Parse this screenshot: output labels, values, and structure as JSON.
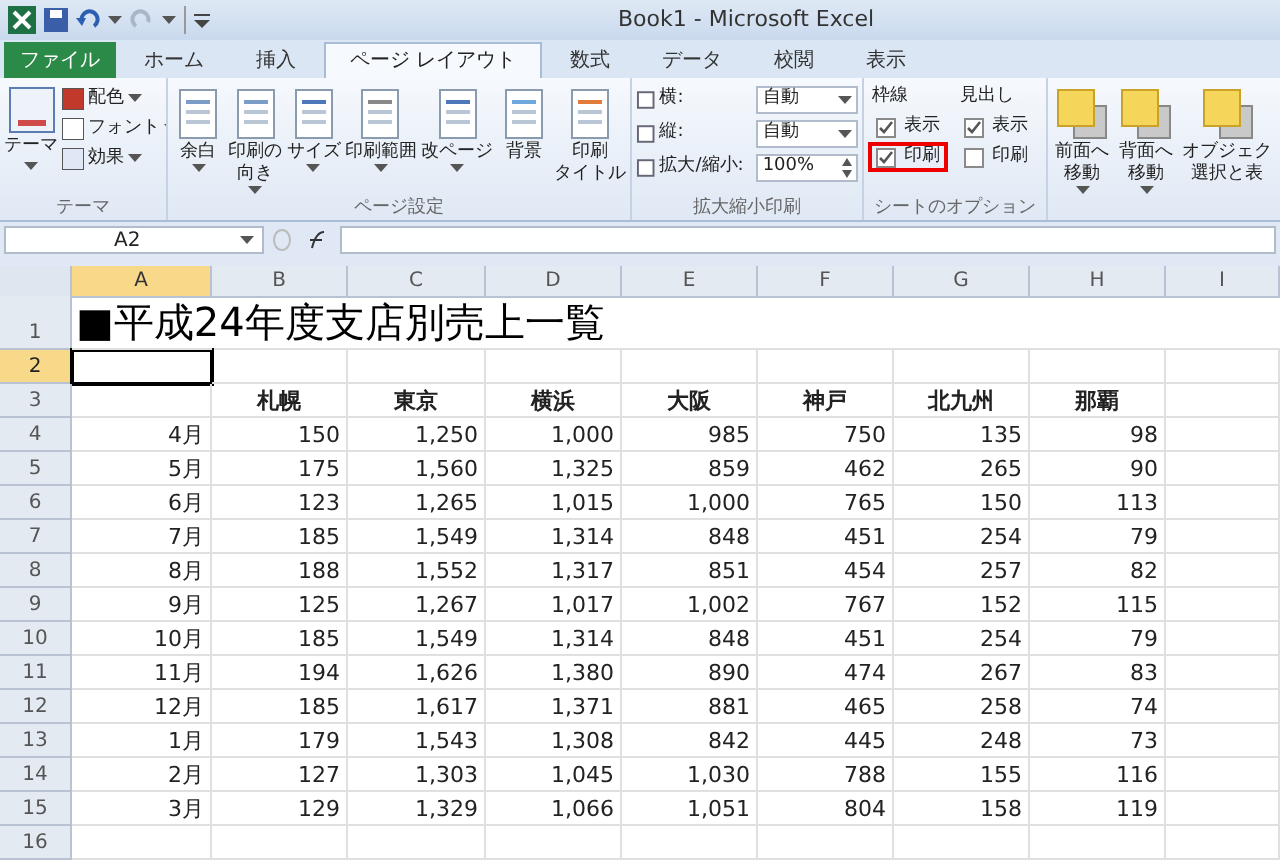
{
  "window": {
    "title": "Book1 - Microsoft Excel"
  },
  "tabs": [
    {
      "label": "ファイル",
      "selected": false,
      "kind": "file"
    },
    {
      "label": "ホーム",
      "selected": false,
      "kind": "tab"
    },
    {
      "label": "挿入",
      "selected": false,
      "kind": "tab"
    },
    {
      "label": "ページ レイアウト",
      "selected": true,
      "kind": "tab"
    },
    {
      "label": "数式",
      "selected": false,
      "kind": "tab"
    },
    {
      "label": "データ",
      "selected": false,
      "kind": "tab"
    },
    {
      "label": "校閲",
      "selected": false,
      "kind": "tab"
    },
    {
      "label": "表示",
      "selected": false,
      "kind": "tab"
    }
  ],
  "ribbon": {
    "theme_group": {
      "title": "テーマ",
      "big": "テーマ",
      "items": [
        "配色",
        "フォント",
        "効果"
      ]
    },
    "page_setup": {
      "title": "ページ設定",
      "buttons": [
        {
          "lines": [
            "余白"
          ],
          "dropdown": true
        },
        {
          "lines": [
            "印刷の",
            "向き"
          ],
          "dropdown": true
        },
        {
          "lines": [
            "サイズ"
          ],
          "dropdown": true
        },
        {
          "lines": [
            "印刷範囲"
          ],
          "dropdown": true
        },
        {
          "lines": [
            "改ページ"
          ],
          "dropdown": true
        },
        {
          "lines": [
            "背景"
          ],
          "dropdown": false
        },
        {
          "lines": [
            "印刷",
            "タイトル"
          ],
          "dropdown": false
        }
      ]
    },
    "scale": {
      "title": "拡大縮小印刷",
      "rows": [
        {
          "label": "横:",
          "value": "自動",
          "kind": "select"
        },
        {
          "label": "縦:",
          "value": "自動",
          "kind": "select"
        },
        {
          "label": "拡大/縮小:",
          "value": "100%",
          "kind": "spin"
        }
      ]
    },
    "sheet_options": {
      "title": "シートのオプション",
      "columns": [
        {
          "title": "枠線",
          "items": [
            {
              "label": "表示",
              "checked": true,
              "highlighted": false
            },
            {
              "label": "印刷",
              "checked": true,
              "highlighted": true
            }
          ]
        },
        {
          "title": "見出し",
          "items": [
            {
              "label": "表示",
              "checked": true,
              "highlighted": false
            },
            {
              "label": "印刷",
              "checked": false,
              "highlighted": false
            }
          ]
        }
      ]
    },
    "arrange": {
      "buttons": [
        {
          "lines": [
            "前面へ",
            "移動"
          ],
          "dropdown": true
        },
        {
          "lines": [
            "背面へ",
            "移動"
          ],
          "dropdown": true
        },
        {
          "lines": [
            "オブジェク",
            "選択と表"
          ],
          "dropdown": false
        }
      ]
    }
  },
  "formula_bar": {
    "name_box": "A2"
  },
  "sheet": {
    "columns": [
      {
        "label": "A",
        "selected": true
      },
      {
        "label": "B",
        "selected": false
      },
      {
        "label": "C",
        "selected": false
      },
      {
        "label": "D",
        "selected": false
      },
      {
        "label": "E",
        "selected": false
      },
      {
        "label": "F",
        "selected": false
      },
      {
        "label": "G",
        "selected": false
      },
      {
        "label": "H",
        "selected": false
      },
      {
        "label": "I",
        "selected": false
      }
    ],
    "rows": [
      {
        "number": "1",
        "kind": "title",
        "selected": false,
        "cells": [
          "■平成24年度支店別売上一覧"
        ]
      },
      {
        "number": "2",
        "kind": "empty",
        "selected": true
      },
      {
        "number": "3",
        "kind": "header",
        "selected": false,
        "cells": [
          "",
          "札幌",
          "東京",
          "横浜",
          "大阪",
          "神戸",
          "北九州",
          "那覇"
        ]
      },
      {
        "number": "4",
        "kind": "data",
        "selected": false,
        "cells": [
          "4月",
          "150",
          "1,250",
          "1,000",
          "985",
          "750",
          "135",
          "98"
        ]
      },
      {
        "number": "5",
        "kind": "data",
        "selected": false,
        "cells": [
          "5月",
          "175",
          "1,560",
          "1,325",
          "859",
          "462",
          "265",
          "90"
        ]
      },
      {
        "number": "6",
        "kind": "data",
        "selected": false,
        "cells": [
          "6月",
          "123",
          "1,265",
          "1,015",
          "1,000",
          "765",
          "150",
          "113"
        ]
      },
      {
        "number": "7",
        "kind": "data",
        "selected": false,
        "cells": [
          "7月",
          "185",
          "1,549",
          "1,314",
          "848",
          "451",
          "254",
          "79"
        ]
      },
      {
        "number": "8",
        "kind": "data",
        "selected": false,
        "cells": [
          "8月",
          "188",
          "1,552",
          "1,317",
          "851",
          "454",
          "257",
          "82"
        ]
      },
      {
        "number": "9",
        "kind": "data",
        "selected": false,
        "cells": [
          "9月",
          "125",
          "1,267",
          "1,017",
          "1,002",
          "767",
          "152",
          "115"
        ]
      },
      {
        "number": "10",
        "kind": "data",
        "selected": false,
        "cells": [
          "10月",
          "185",
          "1,549",
          "1,314",
          "848",
          "451",
          "254",
          "79"
        ]
      },
      {
        "number": "11",
        "kind": "data",
        "selected": false,
        "cells": [
          "11月",
          "194",
          "1,626",
          "1,380",
          "890",
          "474",
          "267",
          "83"
        ]
      },
      {
        "number": "12",
        "kind": "data",
        "selected": false,
        "cells": [
          "12月",
          "185",
          "1,617",
          "1,371",
          "881",
          "465",
          "258",
          "74"
        ]
      },
      {
        "number": "13",
        "kind": "data",
        "selected": false,
        "cells": [
          "1月",
          "179",
          "1,543",
          "1,308",
          "842",
          "445",
          "248",
          "73"
        ]
      },
      {
        "number": "14",
        "kind": "data",
        "selected": false,
        "cells": [
          "2月",
          "127",
          "1,303",
          "1,045",
          "1,030",
          "788",
          "155",
          "116"
        ]
      },
      {
        "number": "15",
        "kind": "data",
        "selected": false,
        "cells": [
          "3月",
          "129",
          "1,329",
          "1,066",
          "1,051",
          "804",
          "158",
          "119"
        ]
      },
      {
        "number": "16",
        "kind": "empty",
        "selected": false
      }
    ]
  }
}
